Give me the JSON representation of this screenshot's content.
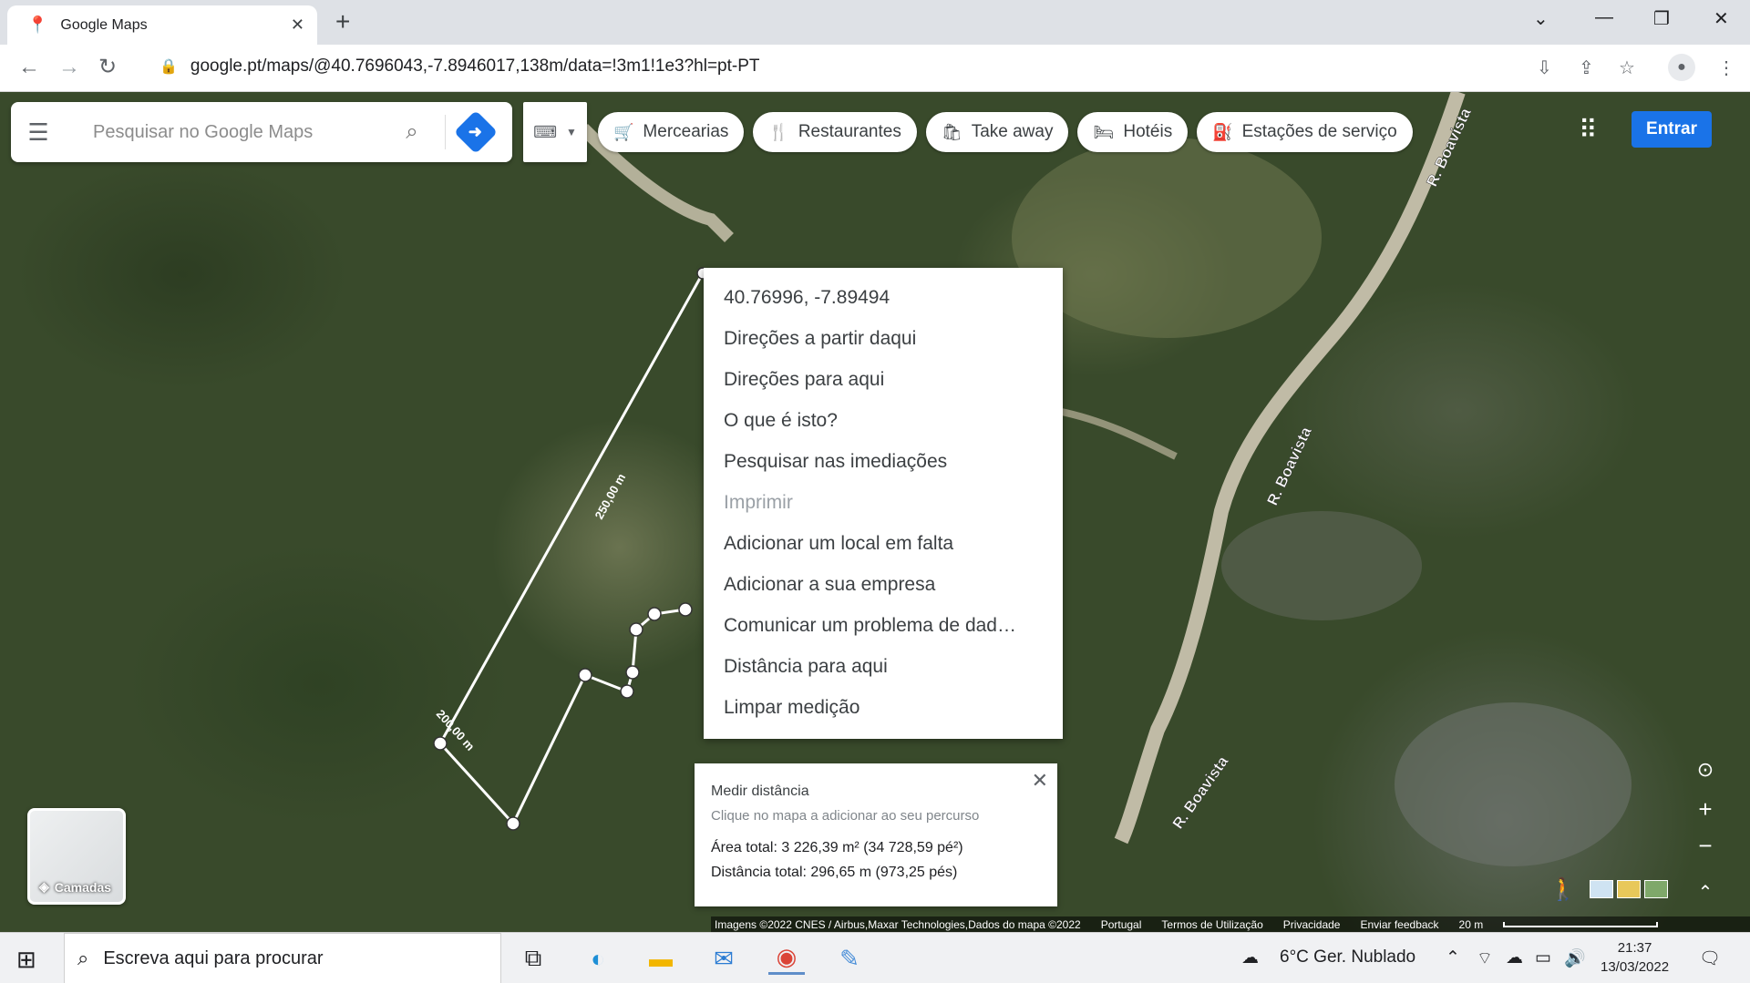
{
  "browser": {
    "tab_title": "Google Maps",
    "url": "google.pt/maps/@40.7696043,-7.8946017,138m/data=!3m1!1e3?hl=pt-PT"
  },
  "search": {
    "placeholder": "Pesquisar no Google Maps"
  },
  "chips": [
    {
      "label": "Mercearias",
      "icon": "cart-icon"
    },
    {
      "label": "Restaurantes",
      "icon": "fork-knife-icon"
    },
    {
      "label": "Take away",
      "icon": "takeaway-bag-icon"
    },
    {
      "label": "Hotéis",
      "icon": "bed-icon"
    },
    {
      "label": "Estações de serviço",
      "icon": "fuel-pump-icon"
    }
  ],
  "signin_label": "Entrar",
  "context_menu": {
    "items": [
      "40.76996, -7.89494",
      "Direções a partir daqui",
      "Direções para aqui",
      "O que é isto?",
      "Pesquisar nas imediações",
      "Imprimir",
      "Adicionar um local em falta",
      "Adicionar a sua empresa",
      "Comunicar um problema de dad…",
      "Distância para aqui",
      "Limpar medição"
    ]
  },
  "measure": {
    "title": "Medir distância",
    "hint": "Clique no mapa a adicionar ao seu percurso",
    "area": "Área total: 3 226,39 m² (34 728,59 pé²)",
    "distance": "Distância total: 296,65 m (973,25 pés)"
  },
  "map_labels": {
    "road1": "R. Boavista",
    "road2": "R. Boavista",
    "road3": "R. Boavista",
    "segment1": "250,00 m",
    "segment2": "200,00 m"
  },
  "layers_label": "Camadas",
  "footer": {
    "attribution": "Imagens ©2022 CNES / Airbus,Maxar Technologies,Dados do mapa ©2022",
    "country": "Portugal",
    "terms": "Termos de Utilização",
    "privacy": "Privacidade",
    "feedback": "Enviar feedback",
    "scale": "20 m"
  },
  "taskbar": {
    "search_text": "Escreva aqui para procurar",
    "weather": "6°C  Ger. Nublado",
    "time": "21:37",
    "date": "13/03/2022"
  }
}
